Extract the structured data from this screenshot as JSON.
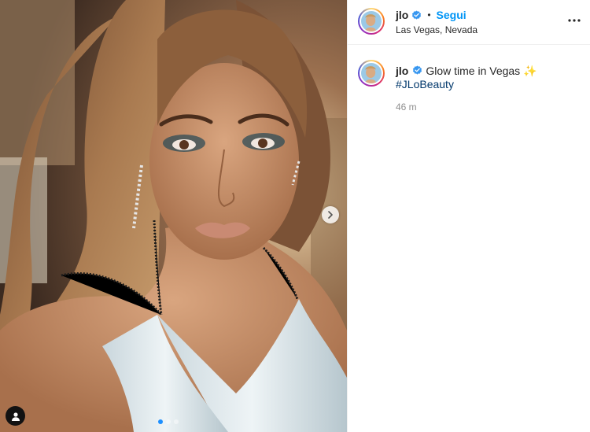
{
  "post": {
    "username": "jlo",
    "follow_label": "Segui",
    "separator": "•",
    "location": "Las Vegas, Nevada",
    "caption": {
      "username": "jlo",
      "text": "Glow time in Vegas",
      "emoji": "✨",
      "hashtag": "#JLoBeauty"
    },
    "timestamp": "46 m"
  },
  "icons": {
    "verified": "verified-badge-icon",
    "more": "more-options-icon",
    "next": "chevron-right-icon",
    "tag": "user-tag-icon"
  },
  "colors": {
    "accent": "#0095f6",
    "hashtag": "#00376b",
    "verified": "#3897f0",
    "muted": "#8e8e8e"
  },
  "carousel": {
    "total": 3,
    "current": 1
  }
}
